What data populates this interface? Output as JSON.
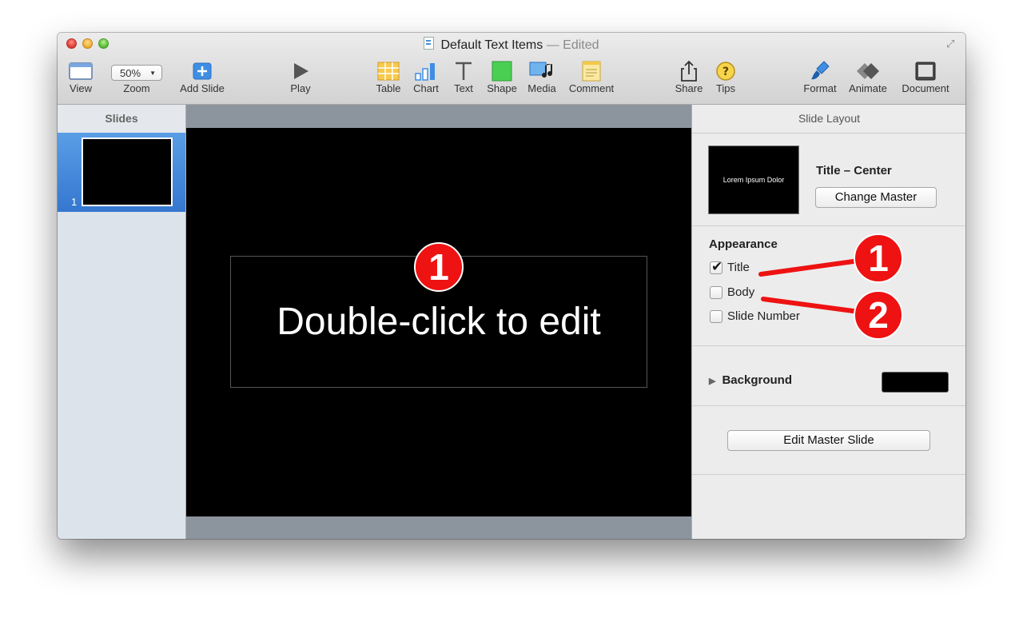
{
  "window": {
    "title": "Default Text Items",
    "title_separator": "—",
    "edited_label": "Edited"
  },
  "toolbar": {
    "view_label": "View",
    "zoom_value": "50%",
    "zoom_label": "Zoom",
    "add_slide_label": "Add Slide",
    "play_label": "Play",
    "table_label": "Table",
    "chart_label": "Chart",
    "text_label": "Text",
    "shape_label": "Shape",
    "media_label": "Media",
    "comment_label": "Comment",
    "share_label": "Share",
    "tips_label": "Tips",
    "format_label": "Format",
    "animate_label": "Animate",
    "document_label": "Document"
  },
  "navigator": {
    "header": "Slides",
    "slides": [
      {
        "number": "1"
      }
    ]
  },
  "canvas": {
    "title_placeholder": "Double-click to edit"
  },
  "inspector": {
    "header": "Slide Layout",
    "master_thumb_text": "Lorem Ipsum Dolor",
    "master_name": "Title – Center",
    "change_master_label": "Change Master",
    "appearance_label": "Appearance",
    "checkboxes": [
      {
        "label": "Title",
        "checked": true
      },
      {
        "label": "Body",
        "checked": false
      },
      {
        "label": "Slide Number",
        "checked": false
      }
    ],
    "background_label": "Background",
    "background_color": "#000000",
    "edit_master_label": "Edit Master Slide"
  },
  "annotations": {
    "badge_title_slide": "1",
    "badge_title_checkbox": "1",
    "badge_body_checkbox": "2",
    "badge_color": "#ee1212"
  }
}
